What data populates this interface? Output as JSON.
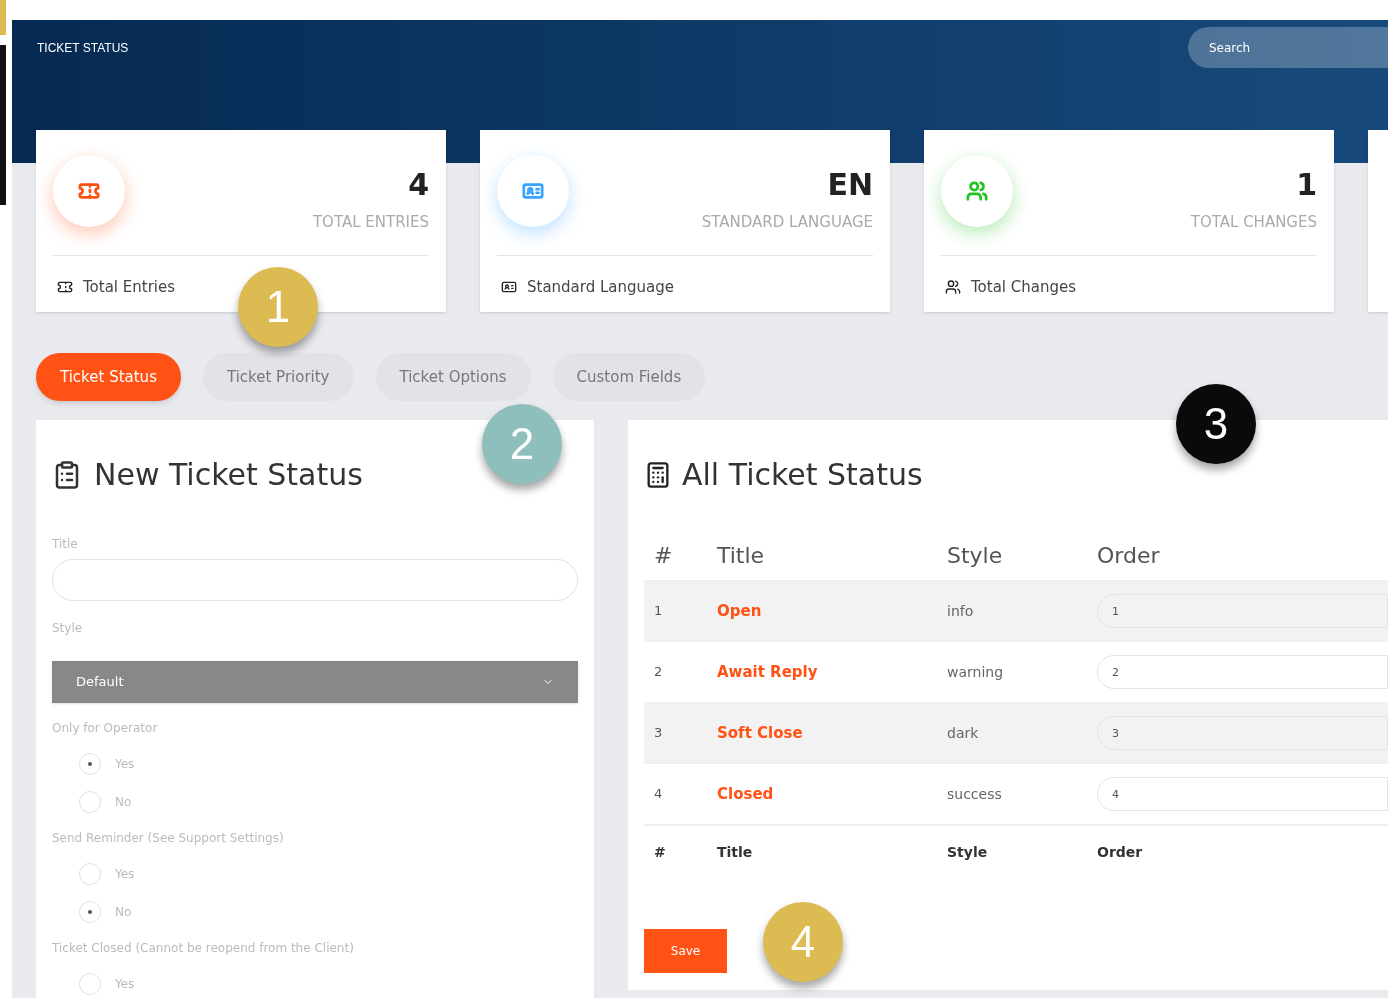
{
  "header": {
    "title": "TICKET STATUS",
    "search": {
      "placeholder": "Search"
    }
  },
  "stats": [
    {
      "value": "4",
      "label": "TOTAL ENTRIES",
      "footer": "Total Entries",
      "color": "#ff5214"
    },
    {
      "value": "EN",
      "label": "STANDARD LANGUAGE",
      "footer": "Standard Language",
      "color": "#3aa3ff"
    },
    {
      "value": "1",
      "label": "TOTAL CHANGES",
      "footer": "Total Changes",
      "color": "#22c322"
    }
  ],
  "tabs": [
    {
      "label": "Ticket Status",
      "selected": true
    },
    {
      "label": "Ticket Priority",
      "selected": false
    },
    {
      "label": "Ticket Options",
      "selected": false
    },
    {
      "label": "Custom Fields",
      "selected": false
    }
  ],
  "new_form": {
    "title": "New Ticket Status",
    "title_label": "Title",
    "style_label": "Style",
    "style_value": "Default",
    "groups": [
      {
        "label": "Only for Operator",
        "options": [
          {
            "label": "Yes",
            "selected": true
          },
          {
            "label": "No",
            "selected": false
          }
        ]
      },
      {
        "label": "Send Reminder (See Support Settings)",
        "options": [
          {
            "label": "Yes",
            "selected": false
          },
          {
            "label": "No",
            "selected": true
          }
        ]
      },
      {
        "label": "Ticket Closed (Cannot be reopend from the Client)",
        "options": [
          {
            "label": "Yes",
            "selected": false
          }
        ]
      }
    ]
  },
  "list": {
    "title": "All Ticket Status",
    "columns": [
      "#",
      "Title",
      "Style",
      "Order"
    ],
    "rows": [
      {
        "number": "1",
        "title": "Open",
        "style": "info",
        "order": "1"
      },
      {
        "number": "2",
        "title": "Await Reply",
        "style": "warning",
        "order": "2"
      },
      {
        "number": "3",
        "title": "Soft Close",
        "style": "dark",
        "order": "3"
      },
      {
        "number": "4",
        "title": "Closed",
        "style": "success",
        "order": "4"
      }
    ],
    "footer_columns": [
      "#",
      "Title",
      "Style",
      "Order"
    ],
    "save": "Save"
  },
  "markers": [
    {
      "label": "1",
      "color": "#dcbb52"
    },
    {
      "label": "2",
      "color": "#8fbfbc"
    },
    {
      "label": "3",
      "color": "#0a0a0a"
    },
    {
      "label": "4",
      "color": "#dcbb52"
    }
  ]
}
